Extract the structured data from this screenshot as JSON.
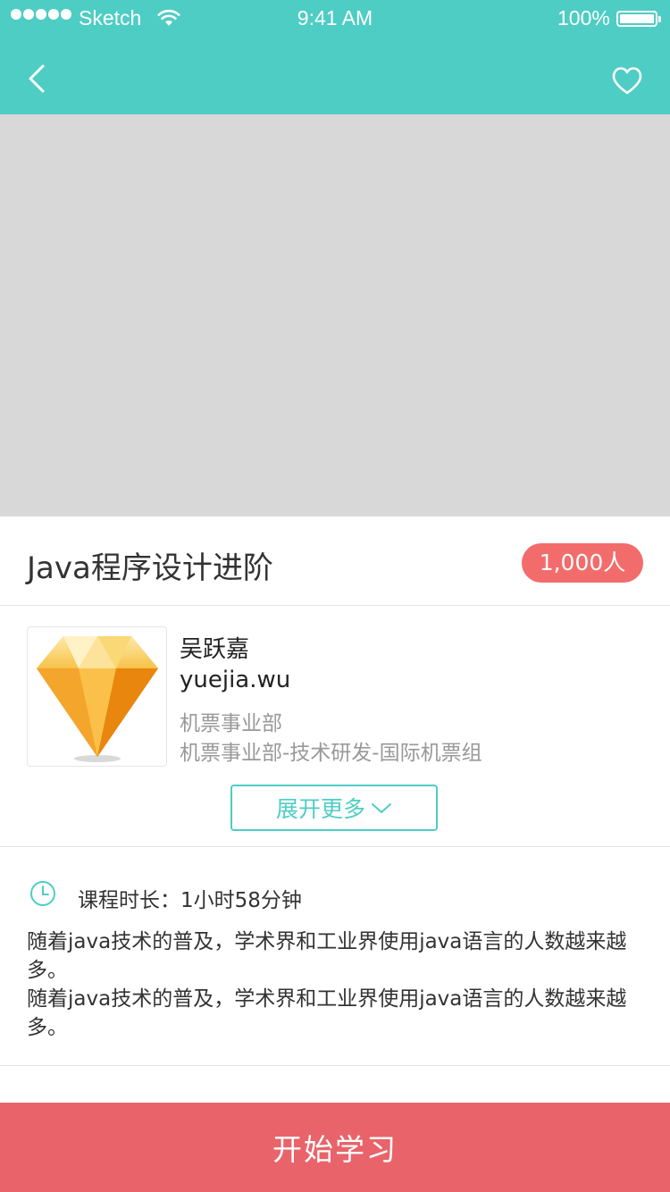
{
  "status_bar": {
    "carrier": "Sketch",
    "time": "9:41 AM",
    "battery": "100%"
  },
  "nav": {
    "back_icon": "chevron-left-icon",
    "favorite_icon": "heart-outline-icon"
  },
  "course": {
    "title": "Java程序设计进阶",
    "enrolled": "1,000人"
  },
  "teacher": {
    "avatar_icon": "sketch-diamond-logo",
    "name": "吴跃嘉",
    "account": "yuejia.wu",
    "department": "机票事业部",
    "group": "机票事业部-技术研发-国际机票组"
  },
  "expand": {
    "label": "展开更多",
    "icon": "chevron-down-icon"
  },
  "detail": {
    "duration_label": "课程时长：",
    "duration_value": "1小时58分钟",
    "description": [
      "随着java技术的普及，学术界和工业界使用java语言的人数越来越多。",
      "随着java技术的普及，学术界和工业界使用java语言的人数越来越多。"
    ]
  },
  "footer": {
    "start_label": "开始学习"
  },
  "colors": {
    "header": "#4ecdc4",
    "accent": "#4ecdc4",
    "badge": "#f36c6c",
    "start_button": "#e8646a",
    "cover_placeholder": "#d8d8d8"
  }
}
